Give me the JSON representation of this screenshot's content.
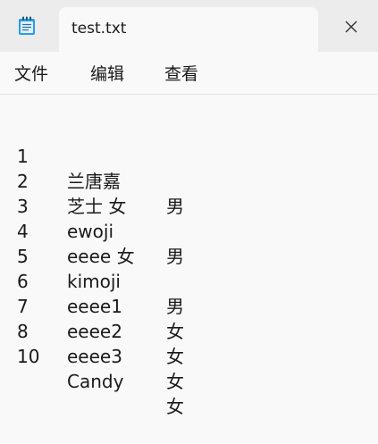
{
  "tab": {
    "title": "test.txt"
  },
  "menu": {
    "file": "文件",
    "edit": "编辑",
    "view": "查看"
  },
  "icons": {
    "app": "notepad-icon",
    "close": "close-icon"
  },
  "document": {
    "lines": [
      {
        "id": "1",
        "name": "兰唐嘉",
        "gender": "男"
      },
      {
        "id": "2",
        "name": "芝士 女"
      },
      {
        "id": "3",
        "name": "ewoji",
        "gender": "男"
      },
      {
        "id": "4",
        "name": "eeee 女"
      },
      {
        "id": "5",
        "name": "kimoji",
        "gender": "男"
      },
      {
        "id": "6",
        "name": "eeee1",
        "gender": "女"
      },
      {
        "id": "7",
        "name": "eeee2",
        "gender": "女"
      },
      {
        "id": "8",
        "name": "eeee3",
        "gender": "女"
      },
      {
        "id": "10",
        "name": "Candy",
        "gender": "女"
      }
    ]
  }
}
